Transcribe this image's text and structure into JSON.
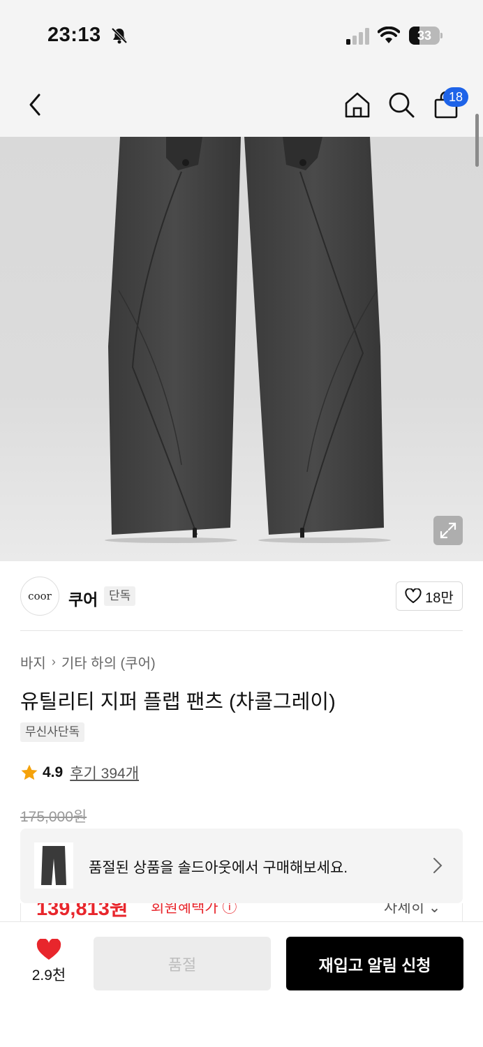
{
  "status_bar": {
    "time": "23:13",
    "battery_level_percent": 33,
    "battery_label": "33",
    "icons": [
      "bell-slash-icon",
      "cellular-signal-icon",
      "wifi-icon",
      "battery-icon"
    ]
  },
  "header": {
    "icons": [
      "chevron-left-icon",
      "home-icon",
      "search-icon",
      "shopping-bag-icon"
    ],
    "cart_count": "18",
    "badge_color": "#1e63e8"
  },
  "product_image": {
    "icon": "expand-icon"
  },
  "brand": {
    "logo_text": "coor",
    "name": "쿠어",
    "tag": "단독",
    "like_count": "18만"
  },
  "product": {
    "breadcrumb": [
      "바지",
      "기타 하의 (쿠어)"
    ],
    "title": "유틸리티 지퍼 플랩 팬츠 (차콜그레이)",
    "badge": "무신사단독",
    "rating": "4.9",
    "review_link": "후기 394개",
    "original_price": "175,000원"
  },
  "banner": {
    "text": "품절된 상품을 솔드아웃에서 구매해보세요."
  },
  "sale": {
    "price": "139,813원",
    "note": "회원혜택가 ⓘ",
    "right_label": "자세히 ⌄"
  },
  "bottom_bar": {
    "wish_count": "2.9천",
    "soldout_label": "품절",
    "restock_label": "재입고 알림 신청",
    "heart_color": "#e8262c"
  }
}
